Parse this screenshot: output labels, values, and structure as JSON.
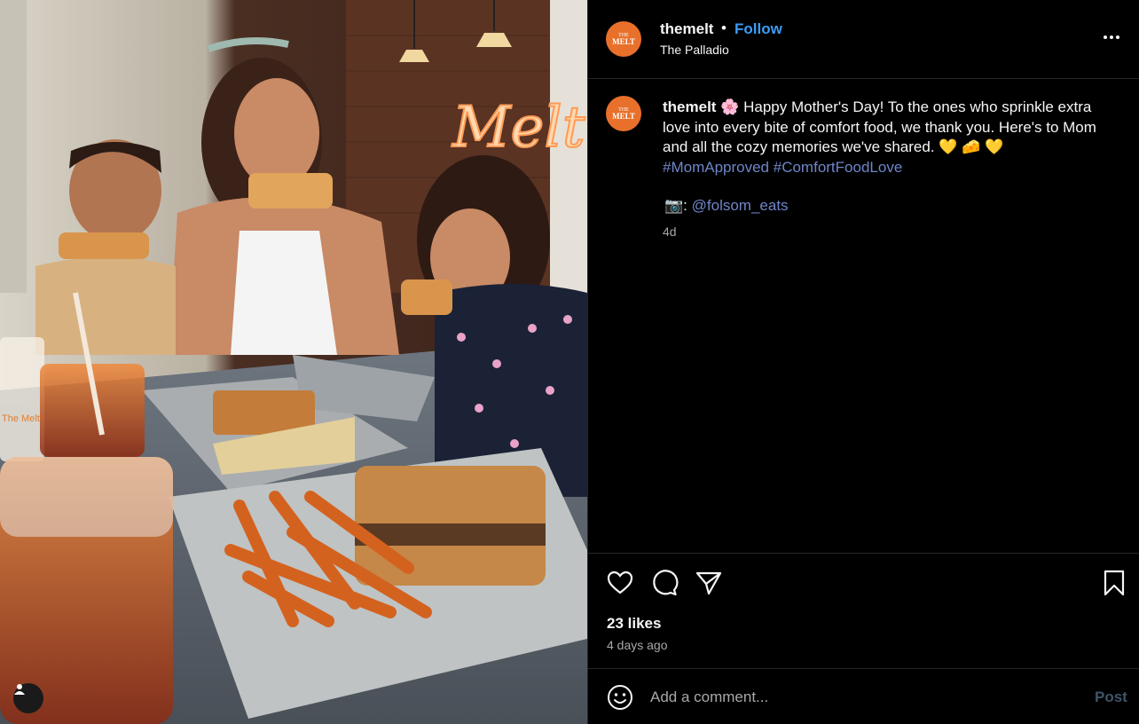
{
  "post": {
    "username": "themelt",
    "separator": "•",
    "follow_label": "Follow",
    "location": "The Palladio",
    "avatar_line1": "THE",
    "avatar_line2": "MELT"
  },
  "photo": {
    "sign_text": "Melt",
    "cup_text": "The Melt"
  },
  "caption": {
    "username": "themelt",
    "flower_emoji": "🌸",
    "text": "Happy Mother's Day! To the ones who sprinkle extra love into every bite of comfort food, we thank you. Here's to Mom and all the cozy memories we've shared.",
    "emojis": "💛 🧀 💛",
    "hashtag1": "#MomApproved",
    "hashtag2": "#ComfortFoodLove",
    "credit_emoji": "📷",
    "credit_sep": ":",
    "credit_handle": "@folsom_eats",
    "age": "4d"
  },
  "engagement": {
    "likes": "23 likes",
    "posted": "4 days ago"
  },
  "comment": {
    "placeholder": "Add a comment...",
    "post_label": "Post"
  },
  "icons": {
    "more": "more-options-icon",
    "like": "heart-icon",
    "comment": "comment-icon",
    "share": "share-icon",
    "save": "bookmark-icon",
    "emoji": "emoji-icon",
    "tagged": "user-icon"
  },
  "colors": {
    "follow": "#3b9cf5",
    "hashtag": "#6f86c8",
    "post_disabled": "#3f5468",
    "avatar": "#e8702a"
  }
}
